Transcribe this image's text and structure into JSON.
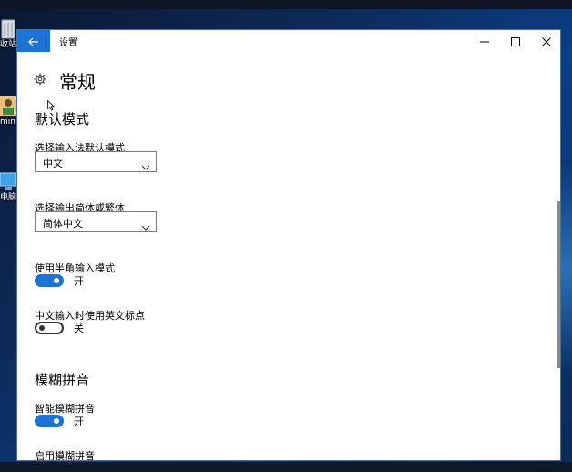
{
  "window": {
    "title": "设置",
    "back_icon": "back-arrow-icon",
    "minimize_icon": "minimize-icon",
    "maximize_icon": "maximize-icon",
    "close_icon": "close-icon"
  },
  "page": {
    "icon": "gear-icon",
    "title": "常规"
  },
  "sections": {
    "default_mode": {
      "title": "默认模式",
      "input_mode_label": "选择输入法默认模式",
      "input_mode_value": "中文",
      "charset_label": "选择输出简体或繁体",
      "charset_value": "简体中文",
      "halfwidth_label": "使用半角输入模式",
      "halfwidth_state": "开",
      "halfwidth_on": true,
      "en_punct_label": "中文输入时使用英文标点",
      "en_punct_state": "关",
      "en_punct_on": false
    },
    "fuzzy_pinyin": {
      "title": "模糊拼音",
      "smart_label": "智能模糊拼音",
      "smart_state": "开",
      "smart_on": true,
      "enable_label": "启用模糊拼音"
    }
  },
  "desktop": {
    "icons": [
      {
        "name": "recycle-bin",
        "label": "收站"
      },
      {
        "name": "user-folder",
        "label": "min"
      },
      {
        "name": "this-pc",
        "label": "电脑"
      }
    ]
  },
  "colors": {
    "accent": "#1c73d3",
    "window_bg": "#ffffff",
    "toggle_off_border": "#333333"
  }
}
